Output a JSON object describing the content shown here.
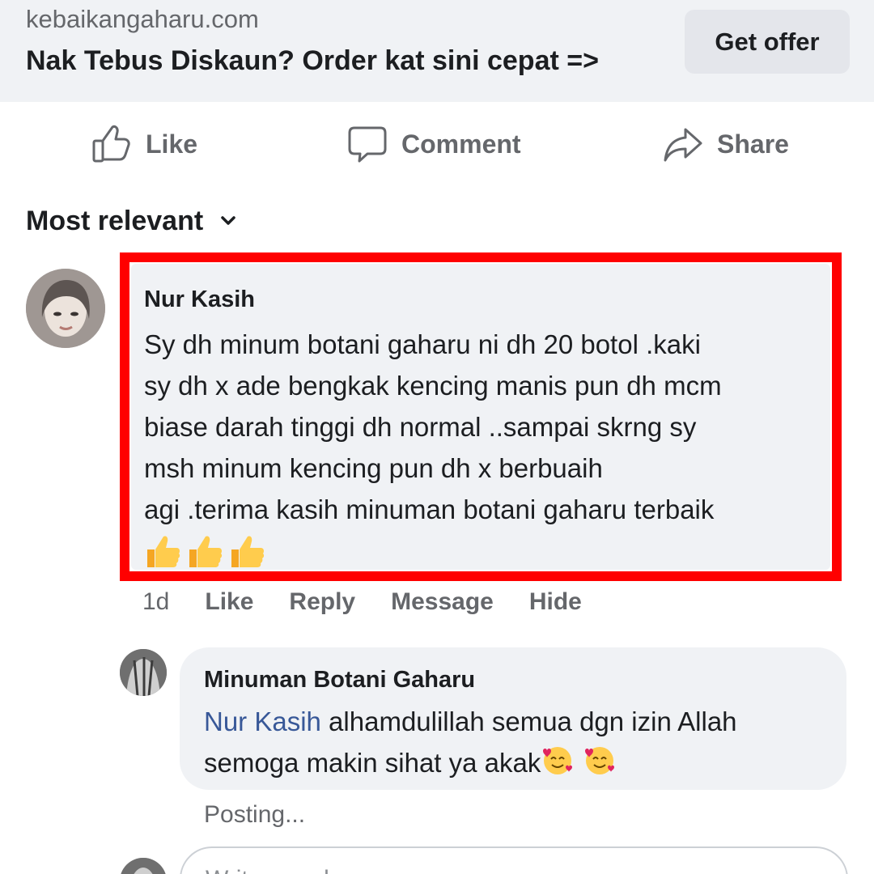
{
  "ad": {
    "domain": "kebaikangaharu.com",
    "headline": "Nak Tebus Diskaun? Order kat sini cepat =>",
    "cta": "Get offer"
  },
  "actions": {
    "like": "Like",
    "comment": "Comment",
    "share": "Share"
  },
  "sort": {
    "label": "Most relevant",
    "icon": "chevron-down-icon"
  },
  "comment": {
    "author": "Nur Kasih",
    "lines": [
      "Sy dh minum botani gaharu ni dh 20 botol .kaki",
      "sy dh x ade bengkak kencing manis pun dh mcm",
      "biase darah tinggi dh normal ..sampai skrng sy",
      "msh minum kencing pun dh x berbuaih",
      "agi .terima kasih minuman botani gaharu terbaik"
    ],
    "emoji": "👍👍👍",
    "time": "1d",
    "like": "Like",
    "reply": "Reply",
    "message": "Message",
    "hide": "Hide",
    "highlight_color": "#ff0000"
  },
  "reply": {
    "author": "Minuman Botani Gaharu",
    "mention": "Nur Kasih",
    "text_1": " alhamdulillah semua dgn izin Allah",
    "text_2": "semoga makin sihat ya akak",
    "emoji": "🥰🥰",
    "status": "Posting..."
  },
  "composer": {
    "placeholder": "Write a reply..."
  },
  "colors": {
    "ad_background": "#f0f2f5",
    "bubble": "#f0f2f5",
    "secondary_text": "#65676b",
    "mention": "#385898"
  }
}
